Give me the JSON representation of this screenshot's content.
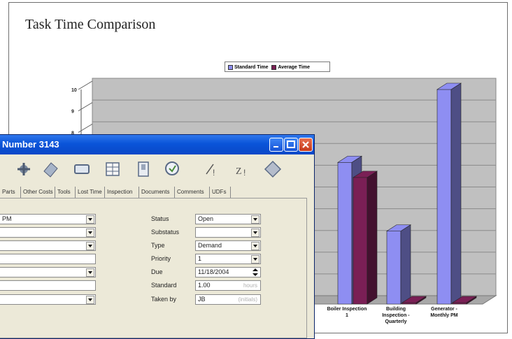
{
  "report": {
    "title": "Task Time Comparison"
  },
  "chart_data": {
    "type": "bar",
    "title": "Task Time Comparison",
    "xlabel": "",
    "ylabel": "",
    "ylim": [
      0,
      10
    ],
    "visible_y_ticks": [
      "10",
      "9",
      "8"
    ],
    "legend_position": "top-center",
    "categories_visible": [
      "Boiler Inspection 1",
      "Building Inspection - Quarterly",
      "Generator - Monthly PM"
    ],
    "series": [
      {
        "name": "Standard Time",
        "color": "#8e8ef2",
        "values": [
          6.6,
          3.4,
          10
        ]
      },
      {
        "name": "Average Time",
        "color": "#7a1f55",
        "values": [
          5.9,
          0,
          0
        ]
      }
    ]
  },
  "dialog": {
    "title": "Number 3143",
    "tabs": [
      "Parts",
      "Other Costs",
      "Tools",
      "Lost Time",
      "Inspection",
      "Documents",
      "Comments",
      "UDFs"
    ],
    "left_fields": [
      "PM",
      "",
      "",
      "",
      "",
      "",
      ""
    ],
    "right_fields": [
      {
        "label": "Status",
        "value": "Open",
        "hint": ""
      },
      {
        "label": "Substatus",
        "value": "",
        "hint": ""
      },
      {
        "label": "Type",
        "value": "Demand",
        "hint": ""
      },
      {
        "label": "Priority",
        "value": "1",
        "hint": ""
      },
      {
        "label": "Due",
        "value": "11/18/2004",
        "hint": ""
      },
      {
        "label": "Standard",
        "value": "1.00",
        "hint": "hours"
      },
      {
        "label": "Taken by",
        "value": "JB",
        "hint": "(initials)"
      }
    ],
    "toolbar_icons": [
      "tools-icon",
      "eraser-icon",
      "display-icon",
      "grid-icon",
      "clipboard-icon",
      "magnifier-icon",
      "sort-asc-icon",
      "sort-desc-icon",
      "help-icon"
    ]
  },
  "colors": {
    "chart_bg": "#c0c0c0",
    "xp_titlebar": "#0a54d9",
    "dialog_bg": "#ece9d8"
  }
}
